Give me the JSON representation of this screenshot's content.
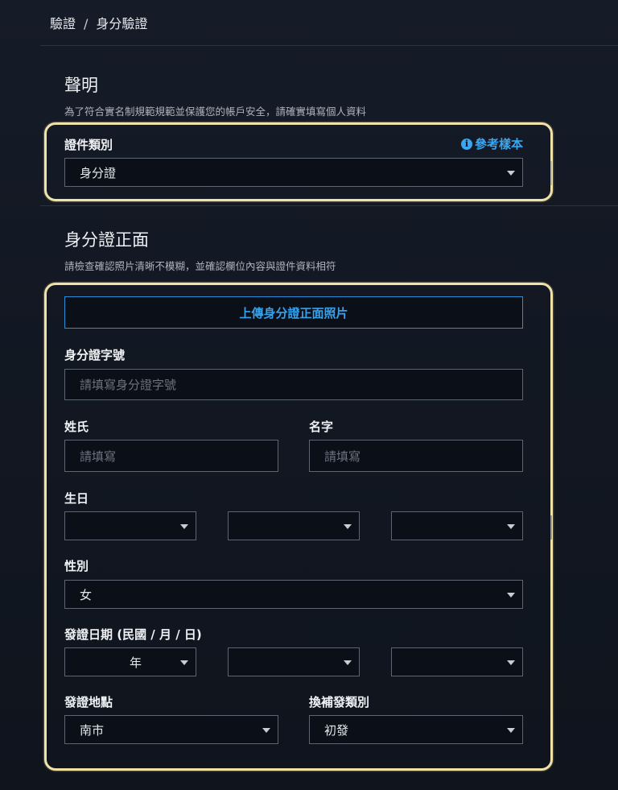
{
  "breadcrumb": {
    "parent": "驗證",
    "separator": "/",
    "current": "身分驗證"
  },
  "declaration": {
    "title": "聲明",
    "subtitle": "為了符合實名制規範規範並保護您的帳戶安全，請確實填寫個人資料",
    "doc_type_label": "證件類別",
    "reference_link": "參考樣本",
    "info_icon": "i",
    "doc_type_value": "身分證"
  },
  "id_front": {
    "title": "身分證正面",
    "subtitle": "請檢查確認照片清晰不模糊，並確認欄位內容與證件資料相符",
    "upload_button": "上傳身分證正面照片",
    "id_number_label": "身分證字號",
    "id_number_placeholder": "請填寫身分證字號",
    "surname_label": "姓氏",
    "surname_placeholder": "請填寫",
    "given_name_label": "名字",
    "given_name_placeholder": "請填寫",
    "birthday_label": "生日",
    "gender_label": "性別",
    "gender_value": "女",
    "issue_date_label": "發證日期 (民國 / 月 / 日)",
    "issue_year_value": "年",
    "issue_place_label": "發證地點",
    "issue_place_value": "南市",
    "issue_type_label": "換補發類別",
    "issue_type_value": "初發"
  },
  "colors": {
    "accent": "#38a1ea",
    "highlight": "#efe2a8",
    "background": "#121722"
  },
  "icons": {
    "dropdown": "chevron-down-icon",
    "info": "info-icon"
  }
}
